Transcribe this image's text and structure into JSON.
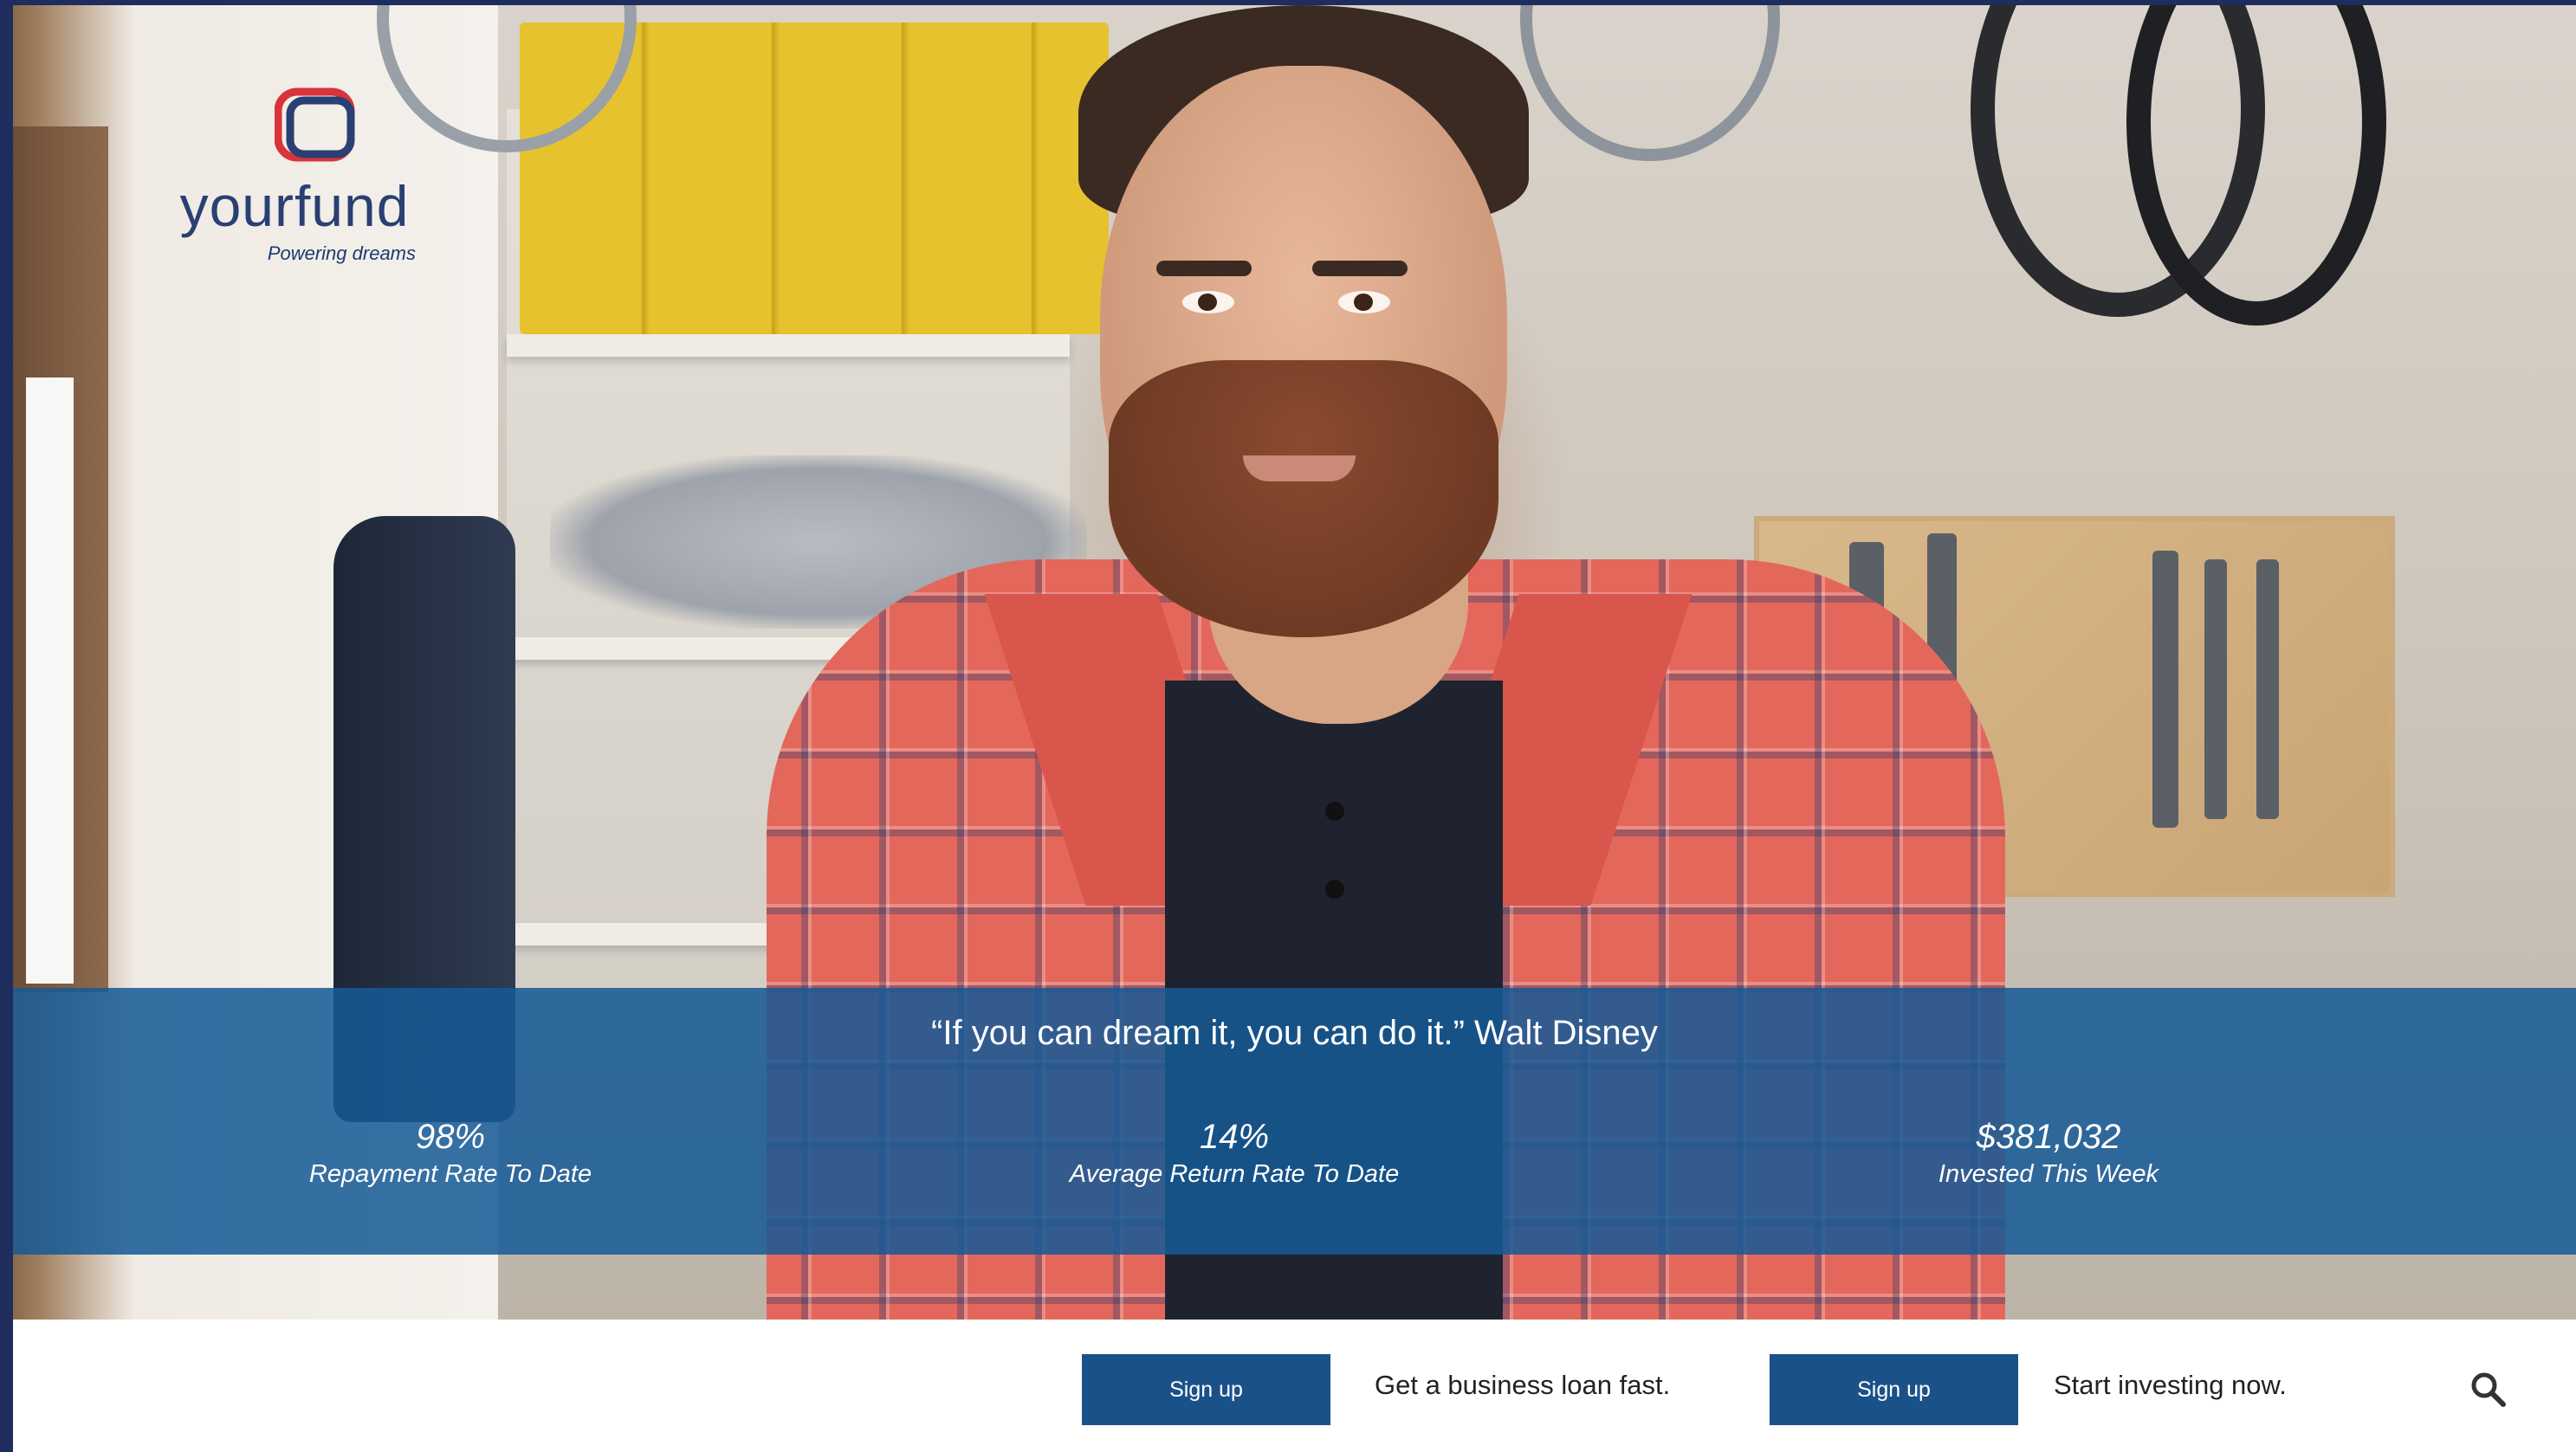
{
  "brand": {
    "name": "yourfund",
    "tagline": "Powering dreams",
    "colors": {
      "mark_red": "#d8343b",
      "mark_navy": "#2a3f73",
      "word": "#2a3f73"
    }
  },
  "hero": {
    "quote": "“If you can dream it, you can do it.” Walt Disney",
    "band_color": "#165a96"
  },
  "stats": [
    {
      "value": "98%",
      "label": "Repayment Rate To Date"
    },
    {
      "value": "14%",
      "label": "Average Return Rate To Date"
    },
    {
      "value": "$381,032",
      "label": "Invested This Week"
    }
  ],
  "cta": {
    "borrow": {
      "button": "Sign up",
      "text": "Get a business loan fast."
    },
    "invest": {
      "button": "Sign up",
      "text": "Start investing now."
    },
    "button_color": "#1b5189"
  },
  "icons": {
    "search": "search-icon"
  }
}
